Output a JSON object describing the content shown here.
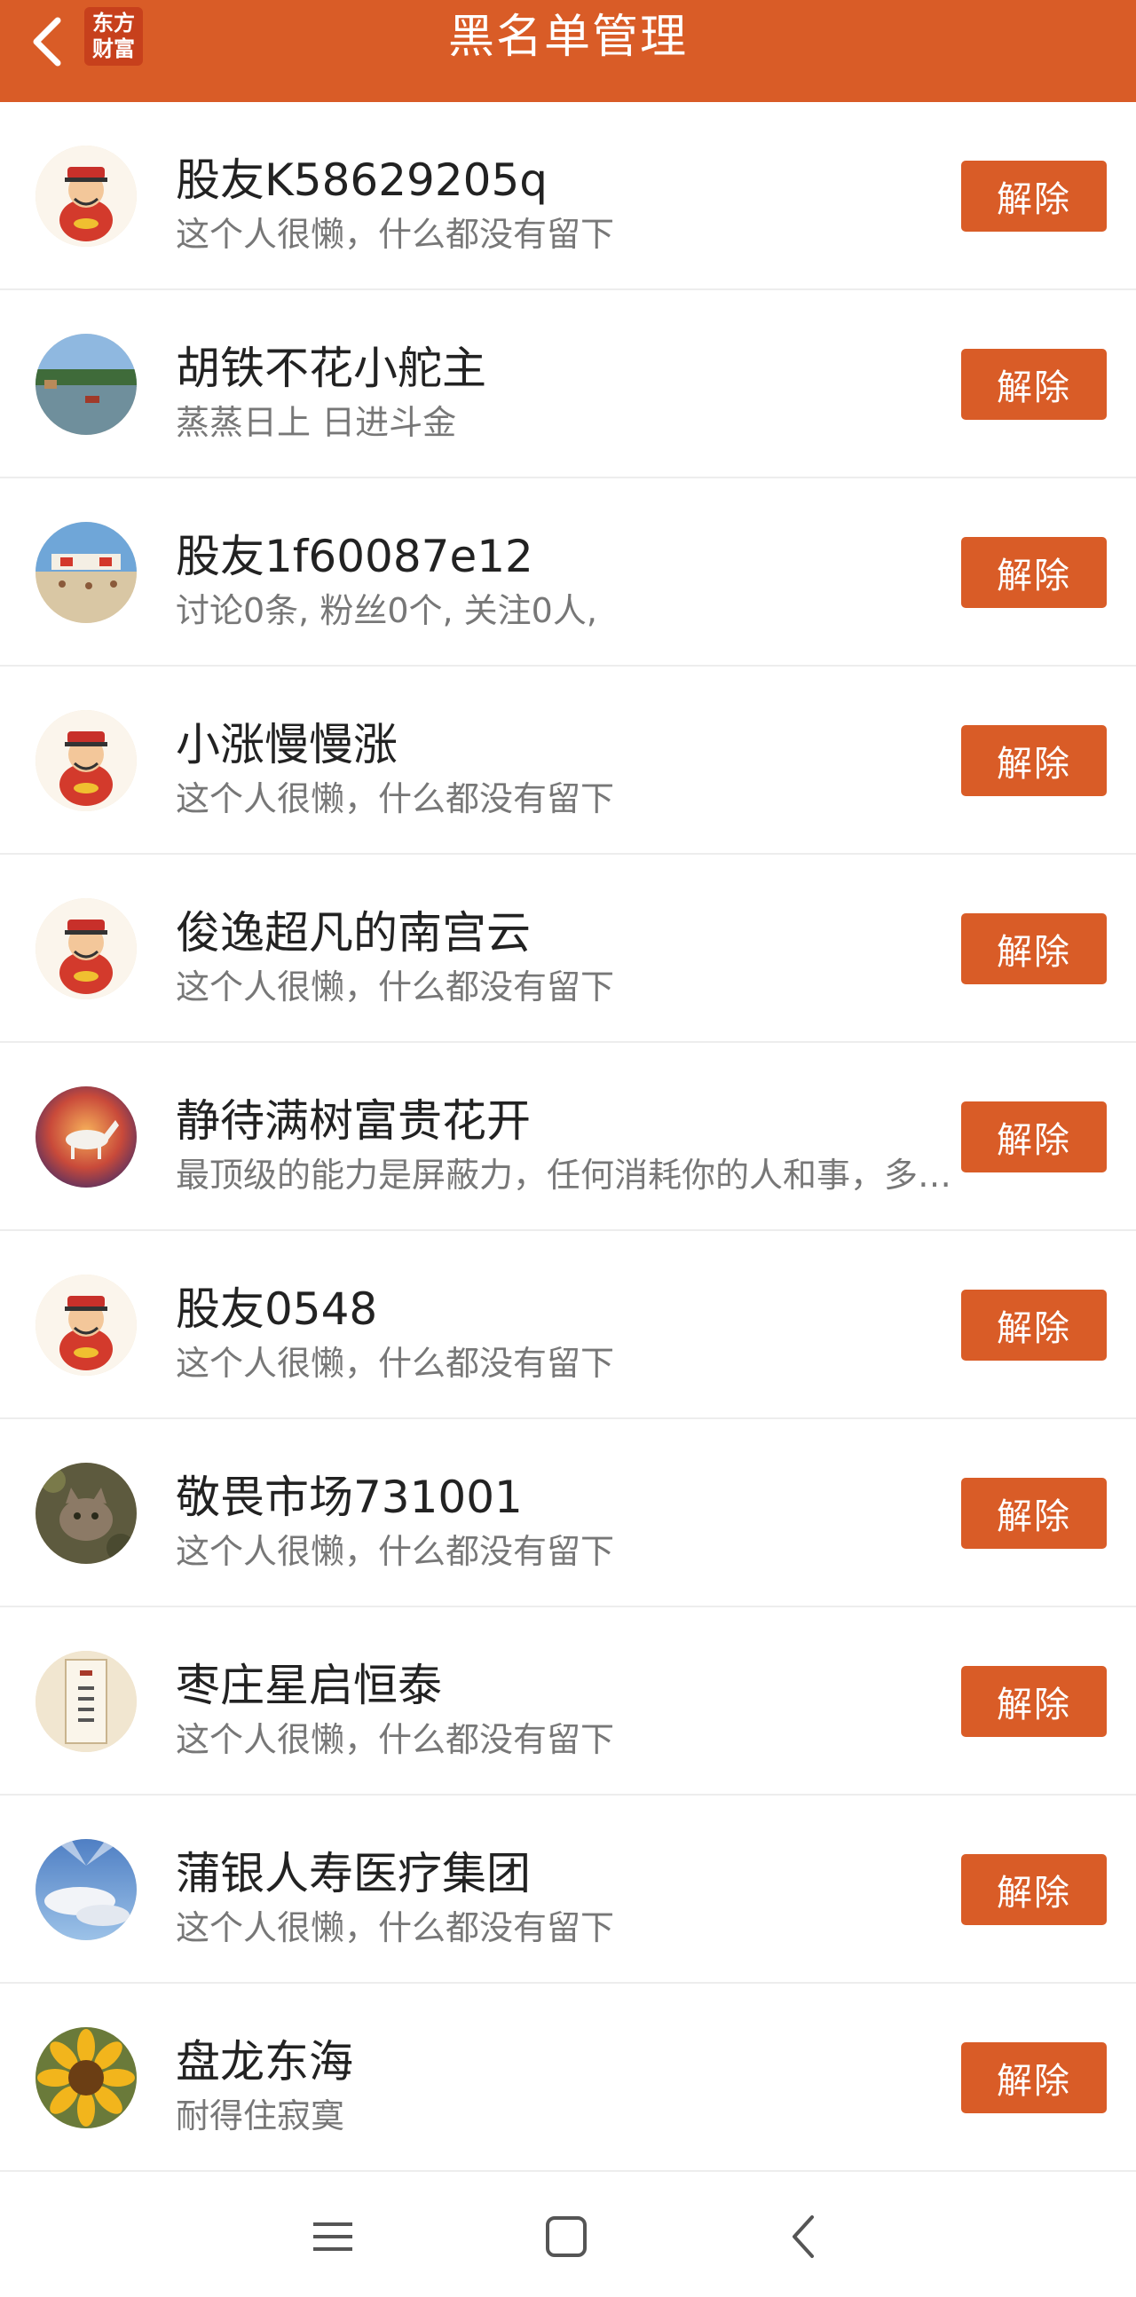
{
  "header": {
    "title": "黑名单管理",
    "logo_line1": "东方",
    "logo_line2": "财富",
    "back_icon": "chevron-left-icon",
    "color": "#d95c27"
  },
  "unblock_label": "解除",
  "users": [
    {
      "name": "股友K58629205q",
      "bio": "这个人很懒，什么都没有留下",
      "avatar": "fortune-god-avatar"
    },
    {
      "name": "胡铁不花小舵主",
      "bio": "蒸蒸日上 日进斗金",
      "avatar": "river-scene-avatar"
    },
    {
      "name": "股友1f60087e12",
      "bio": "讨论0条, 粉丝0个, 关注0人,",
      "avatar": "beach-sign-avatar"
    },
    {
      "name": "小涨慢慢涨",
      "bio": "这个人很懒，什么都没有留下",
      "avatar": "fortune-god-avatar"
    },
    {
      "name": "俊逸超凡的南宫云",
      "bio": "这个人很懒，什么都没有留下",
      "avatar": "fortune-god-avatar"
    },
    {
      "name": "静待满树富贵花开",
      "bio": "最顶级的能力是屏蔽力，任何消耗你的人和事，多看一眼都是你的不对",
      "avatar": "white-horse-sunset-avatar"
    },
    {
      "name": "股友0548",
      "bio": "这个人很懒，什么都没有留下",
      "avatar": "fortune-god-avatar"
    },
    {
      "name": "敬畏市场731001",
      "bio": "这个人很懒，什么都没有留下",
      "avatar": "cat-avatar"
    },
    {
      "name": "枣庄星启恒泰",
      "bio": "这个人很懒，什么都没有留下",
      "avatar": "calligraphy-scroll-avatar"
    },
    {
      "name": "蒲银人寿医疗集团",
      "bio": "这个人很懒，什么都没有留下",
      "avatar": "sky-rays-avatar"
    },
    {
      "name": "盘龙东海",
      "bio": "耐得住寂寞",
      "avatar": "sunflower-avatar"
    }
  ],
  "navbar": {
    "menu_icon": "menu-icon",
    "home_icon": "square-home-icon",
    "back_icon": "back-arrow-icon"
  }
}
